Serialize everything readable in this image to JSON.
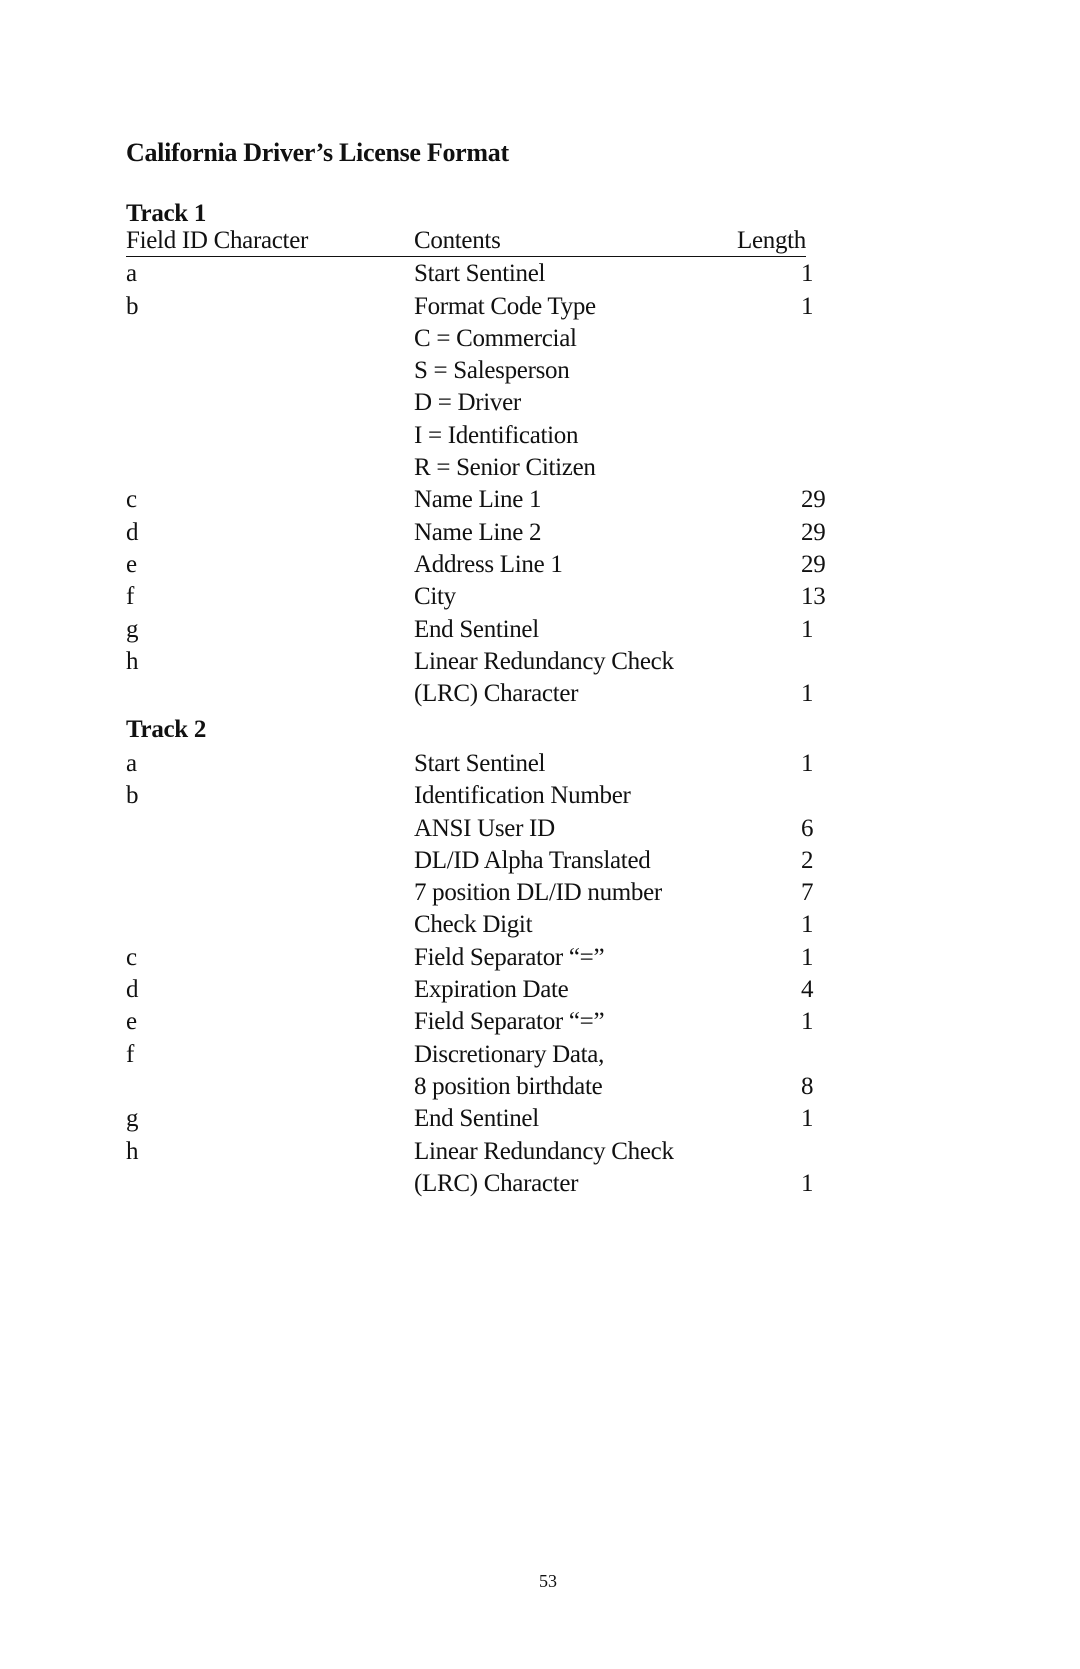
{
  "title": "California Driver’s License Format",
  "track1": {
    "heading": "Track 1",
    "columns": {
      "field_id": "Field ID Character",
      "contents": "Contents",
      "length": "Length"
    },
    "rows": [
      {
        "id": "a",
        "contents": "Start Sentinel",
        "length": "1"
      },
      {
        "id": "b",
        "contents": "Format Code Type",
        "length": "1"
      },
      {
        "id": "",
        "contents": "C = Commercial",
        "length": ""
      },
      {
        "id": "",
        "contents": "S = Salesperson",
        "length": ""
      },
      {
        "id": "",
        "contents": "D = Driver",
        "length": ""
      },
      {
        "id": "",
        "contents": "I = Identification",
        "length": ""
      },
      {
        "id": "",
        "contents": "R = Senior Citizen",
        "length": ""
      },
      {
        "id": "c",
        "contents": "Name Line 1",
        "length": "29"
      },
      {
        "id": "d",
        "contents": "Name Line 2",
        "length": "29"
      },
      {
        "id": "e",
        "contents": "Address Line 1",
        "length": "29"
      },
      {
        "id": "f",
        "contents": "City",
        "length": "13"
      },
      {
        "id": "g",
        "contents": "End Sentinel",
        "length": "1"
      },
      {
        "id": "h",
        "contents": "Linear Redundancy Check",
        "length": ""
      },
      {
        "id": "",
        "contents": "(LRC) Character",
        "length": "1"
      }
    ]
  },
  "track2": {
    "heading": "Track 2",
    "rows": [
      {
        "id": "a",
        "contents": "Start Sentinel",
        "length": "1"
      },
      {
        "id": "b",
        "contents": "Identification Number",
        "length": ""
      },
      {
        "id": "",
        "contents": "ANSI User ID",
        "length": "6"
      },
      {
        "id": "",
        "contents": "DL/ID Alpha Translated",
        "length": "2"
      },
      {
        "id": "",
        "contents": "7 position DL/ID number",
        "length": "7"
      },
      {
        "id": "",
        "contents": "Check Digit",
        "length": "1"
      },
      {
        "id": "c",
        "contents": "Field Separator “=”",
        "length": "1"
      },
      {
        "id": "d",
        "contents": "Expiration Date",
        "length": "4"
      },
      {
        "id": "e",
        "contents": "Field Separator “=”",
        "length": "1"
      },
      {
        "id": "f",
        "contents": "Discretionary Data,",
        "length": ""
      },
      {
        "id": "",
        "contents": "8 position birthdate",
        "length": "8"
      },
      {
        "id": "g",
        "contents": "End Sentinel",
        "length": "1"
      },
      {
        "id": "h",
        "contents": "Linear Redundancy Check",
        "length": ""
      },
      {
        "id": "",
        "contents": "(LRC) Character",
        "length": "1"
      }
    ]
  },
  "page_number": "53"
}
